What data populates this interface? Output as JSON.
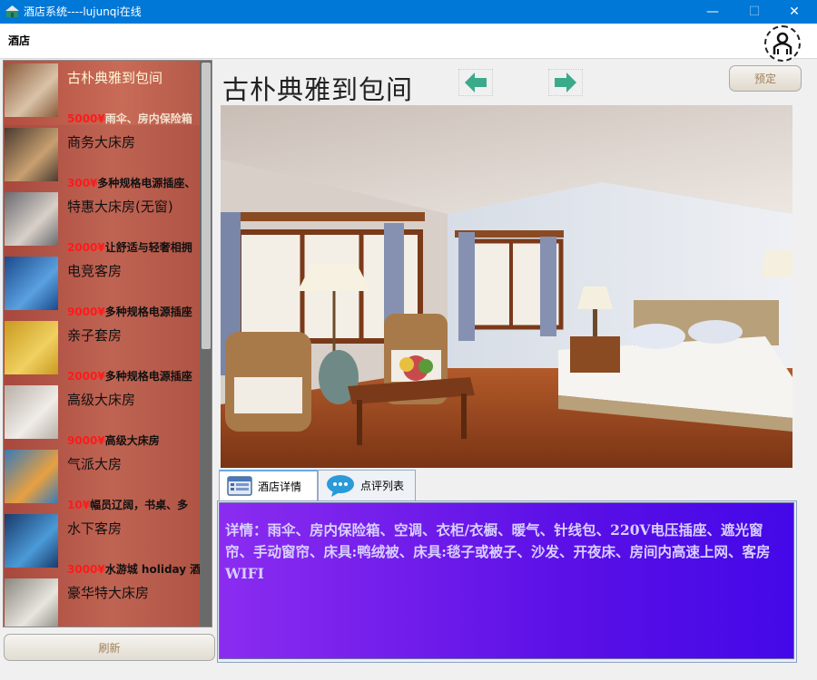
{
  "window": {
    "title": "酒店系统----lujunqi在线",
    "minimize": "—",
    "maximize": "☐",
    "close": "✕"
  },
  "menu": {
    "item": "酒店"
  },
  "rooms": [
    {
      "name": "古朴典雅到包间",
      "price": "5000¥",
      "desc": "雨伞、房内保险箱",
      "selected": true
    },
    {
      "name": "商务大床房",
      "price": "300¥",
      "desc": "多种规格电源插座、"
    },
    {
      "name": "特惠大床房(无窗)",
      "price": "2000¥",
      "desc": "让舒适与轻奢相拥"
    },
    {
      "name": "电竞客房",
      "price": "9000¥",
      "desc": "多种规格电源插座"
    },
    {
      "name": "亲子套房",
      "price": "2000¥",
      "desc": "多种规格电源插座"
    },
    {
      "name": "高级大床房",
      "price": "9000¥",
      "desc": "高级大床房"
    },
    {
      "name": "气派大房",
      "price": "10¥",
      "desc": "幅员辽阔，书桌、多"
    },
    {
      "name": "水下客房",
      "price": "3000¥",
      "desc": "水游城 holiday 酒店"
    },
    {
      "name": "豪华特大床房",
      "price": "",
      "desc": ""
    }
  ],
  "refresh_label": "刷新",
  "detail": {
    "title": "古朴典雅到包间",
    "book_label": "预定",
    "tabs": [
      "酒店详情",
      "点评列表"
    ],
    "description": "详情：雨伞、房内保险箱、空调、衣柜/衣橱、暖气、针线包、220V电压插座、遮光窗帘、手动窗帘、床具:鸭绒被、床具:毯子或被子、沙发、开夜床、房间内高速上网、客房WIFI"
  },
  "colors": {
    "titlebar": "#0078d7",
    "list_bg": "#b5574a",
    "price": "#ff1a1a",
    "arrow": "#3aaa8a",
    "desc_bg": "#6b14ec"
  },
  "icons": {
    "app": "hotel-app-icon",
    "prev": "arrow-left-icon",
    "next": "arrow-right-icon",
    "tab1": "list-icon",
    "tab2": "chat-bubble-icon"
  }
}
